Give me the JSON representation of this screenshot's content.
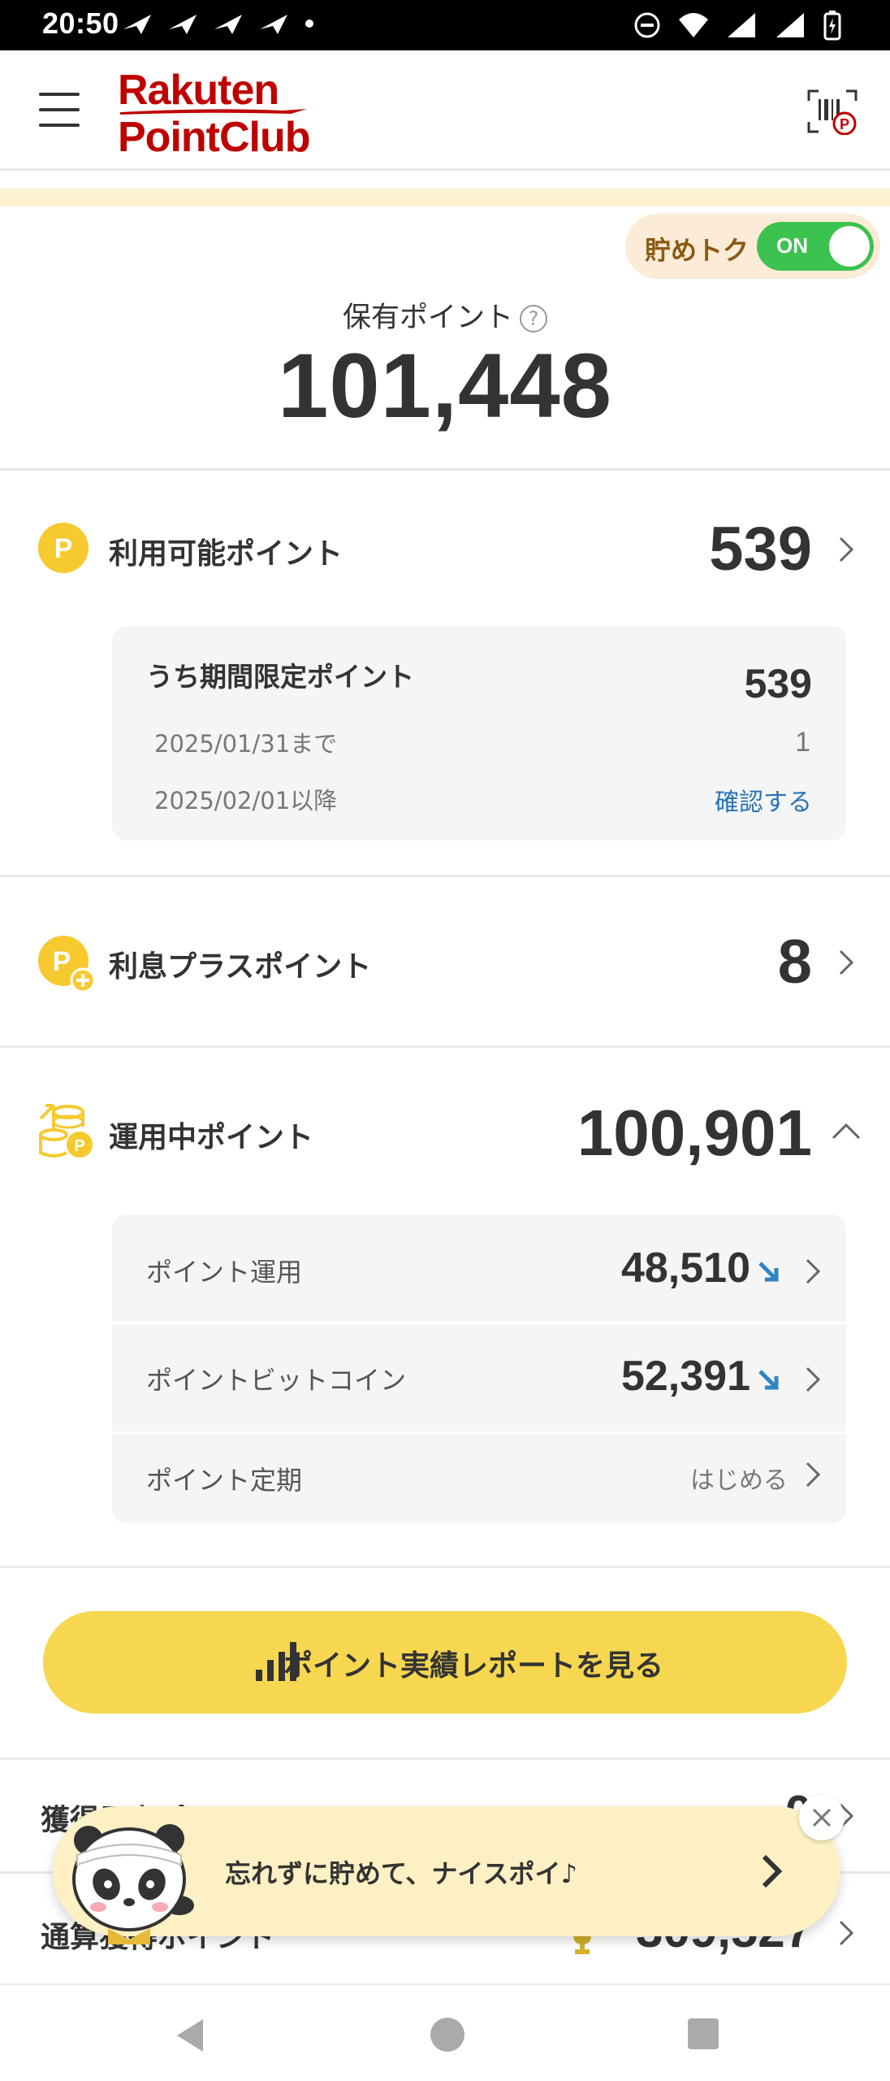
{
  "status_bar": {
    "time": "20:50"
  },
  "header": {
    "logo_line1": "Rakuten",
    "logo_line2": "PointClub",
    "brand_color": "#bf0000"
  },
  "toggle": {
    "label": "貯めトク",
    "state": "ON"
  },
  "total": {
    "label": "保有ポイント",
    "help": "?",
    "value": "101,448"
  },
  "available": {
    "title": "利用可能ポイント",
    "value": "539",
    "limited": {
      "title": "うち期間限定ポイント",
      "value": "539",
      "rows": [
        {
          "date": "2025/01/31まで",
          "value": "1"
        },
        {
          "date": "2025/02/01以降",
          "value": "確認する"
        }
      ]
    }
  },
  "interest": {
    "title": "利息プラスポイント",
    "value": "8"
  },
  "investing": {
    "title": "運用中ポイント",
    "value": "100,901",
    "items": [
      {
        "label": "ポイント運用",
        "value": "48,510"
      },
      {
        "label": "ポイントビットコイン",
        "value": "52,391"
      },
      {
        "label": "ポイント定期",
        "value": "はじめる"
      }
    ]
  },
  "report_button": {
    "label": "ポイント実績レポートを見る"
  },
  "partial_rows": [
    {
      "label": "獲得予定ポイント",
      "value": "0"
    },
    {
      "label": "通算獲得ポイント",
      "value": "309,527"
    }
  ],
  "banner": {
    "message": "忘れずに貯めて、ナイスポイ♪"
  },
  "colors": {
    "accent_yellow": "#f6d74f",
    "toggle_green": "#3cc24e",
    "link_blue": "#2873b8",
    "arrow_blue": "#2f84c6"
  }
}
